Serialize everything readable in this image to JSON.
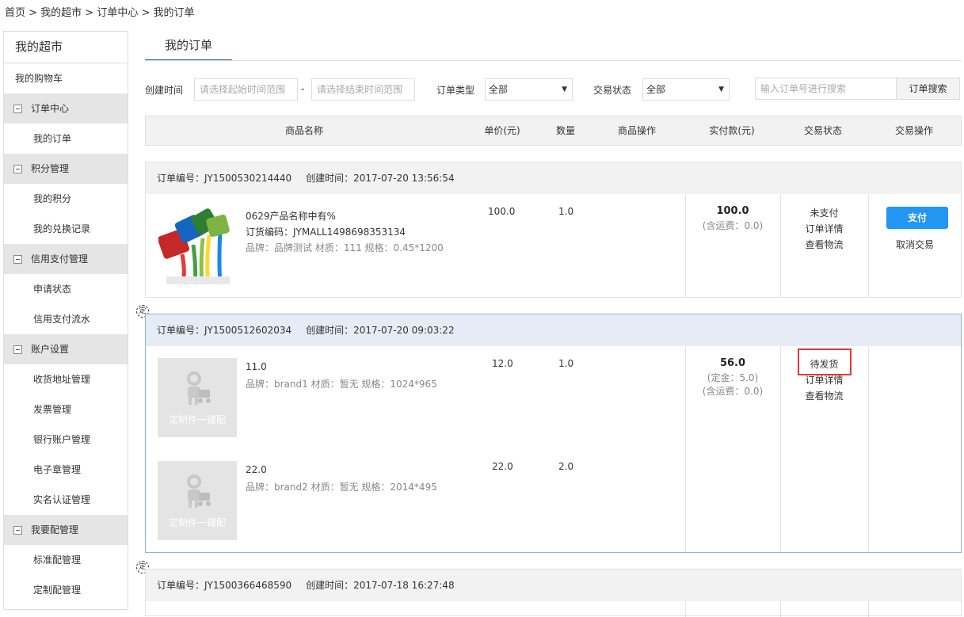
{
  "breadcrumb": "首页 > 我的超市 > 订单中心 > 我的订单",
  "sidebar": {
    "title": "我的超市",
    "cart": "我的购物车",
    "groups": [
      {
        "label": "订单中心",
        "items": [
          "我的订单"
        ]
      },
      {
        "label": "积分管理",
        "items": [
          "我的积分",
          "我的兑换记录"
        ]
      },
      {
        "label": "信用支付管理",
        "items": [
          "申请状态",
          "信用支付流水"
        ]
      },
      {
        "label": "账户设置",
        "items": [
          "收货地址管理",
          "发票管理",
          "银行账户管理",
          "电子章管理",
          "实名认证管理"
        ]
      },
      {
        "label": "我要配管理",
        "items": [
          "标准配管理",
          "定制配管理"
        ]
      }
    ]
  },
  "tab": "我的订单",
  "filters": {
    "created_label": "创建时间",
    "start_placeholder": "请选择起始时间范围",
    "dash": "-",
    "end_placeholder": "请选择结束时间范围",
    "type_label": "订单类型",
    "type_value": "全部",
    "status_label": "交易状态",
    "status_value": "全部",
    "search_placeholder": "输入订单号进行搜索",
    "search_button": "订单搜索"
  },
  "columns": [
    "商品名称",
    "单价(元)",
    "数量",
    "商品操作",
    "实付款(元)",
    "交易状态",
    "交易操作"
  ],
  "orders": [
    {
      "no": "订单编号：JY1500530214440",
      "created": "创建时间：2017-07-20 13:56:54",
      "product": {
        "name": "0629产品名称中有%",
        "code": "订货编码：JYMALL1498698353134",
        "attrs": "品牌：品牌测试 材质：111 规格：0.45*1200",
        "price": "100.0",
        "qty": "1.0"
      },
      "paid": "100.0",
      "paid_note": "(含运费：0.0)",
      "status": "未支付",
      "detail": "订单详情",
      "logistics": "查看物流",
      "pay_button": "支付",
      "cancel": "取消交易"
    },
    {
      "no": "订单编号：JY1500512602034",
      "created": "创建时间：2017-07-20 09:03:22",
      "products": [
        {
          "name": "11.0",
          "attrs": "品牌：brand1 材质：暂无 规格：1024*965",
          "price": "12.0",
          "qty": "1.0",
          "placeholder": "定制件一键配"
        },
        {
          "name": "22.0",
          "attrs": "品牌：brand2 材质：暂无 规格：2014*495",
          "price": "22.0",
          "qty": "2.0",
          "placeholder": "定制件一键配"
        }
      ],
      "paid": "56.0",
      "deposit": "(定金：5.0)",
      "paid_note": "(含运费：0.0)",
      "status": "待发货",
      "detail": "订单详情",
      "logistics": "查看物流"
    },
    {
      "no": "订单编号：JY1500366468590",
      "created": "创建时间：2017-07-18 16:27:48"
    }
  ],
  "ding_mark": "定",
  "colors": {
    "accent": "#1f5ba8",
    "pay": "#2196f3",
    "highlight": "#e53935"
  }
}
